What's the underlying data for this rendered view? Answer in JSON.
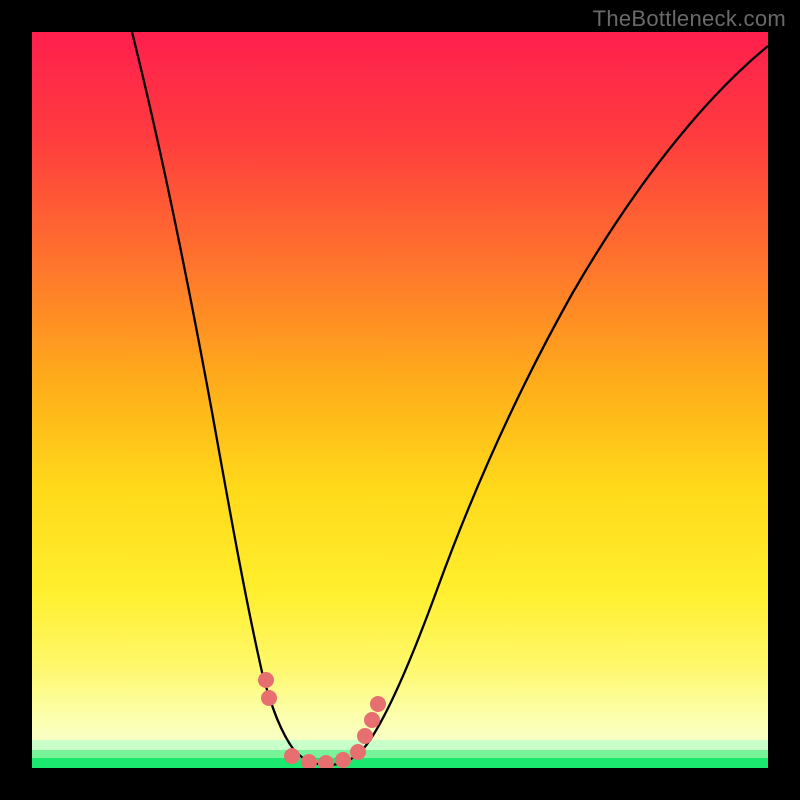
{
  "watermark": "TheBottleneck.com",
  "chart_data": {
    "type": "line",
    "title": "",
    "xlabel": "",
    "ylabel": "",
    "xlim": [
      0,
      100
    ],
    "ylim": [
      0,
      100
    ],
    "grid": false,
    "legend": false,
    "series": [
      {
        "name": "bottleneck-curve",
        "x": [
          13.6,
          17.1,
          21.5,
          24.4,
          28.6,
          31.3,
          34.0,
          35.6,
          38.5,
          40.2,
          43.1,
          45.1,
          50.9,
          55.2,
          59.8,
          65.9,
          73.4,
          81.5,
          90.8,
          100.0
        ],
        "y": [
          100.0,
          83.7,
          63.9,
          48.4,
          34.8,
          23.2,
          13.0,
          7.9,
          4.7,
          2.5,
          0.4,
          0.4,
          2.7,
          12.6,
          24.6,
          38.5,
          51.4,
          64.4,
          78.5,
          90.5,
          98.1
        ]
      }
    ],
    "highlight_points": {
      "name": "low-bottleneck-markers",
      "color": "#e86f6f",
      "x": [
        31.8,
        32.2,
        35.3,
        37.6,
        39.9,
        42.3,
        44.3,
        45.2,
        46.2,
        47.0
      ],
      "y": [
        12.0,
        9.5,
        1.6,
        0.8,
        0.7,
        1.1,
        2.2,
        4.3,
        6.5,
        8.7
      ]
    },
    "background_gradient": {
      "orientation": "vertical",
      "stops": [
        {
          "pos": 0.0,
          "color": "#ff1f4e"
        },
        {
          "pos": 0.3,
          "color": "#ff6f2e"
        },
        {
          "pos": 0.62,
          "color": "#ffd91a"
        },
        {
          "pos": 0.86,
          "color": "#fff86a"
        },
        {
          "pos": 0.97,
          "color": "#c9ffc9"
        },
        {
          "pos": 1.0,
          "color": "#1be86f"
        }
      ]
    }
  }
}
